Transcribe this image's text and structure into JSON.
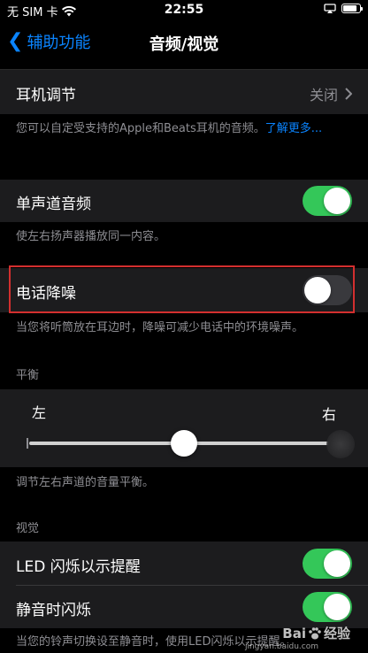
{
  "status_bar": {
    "carrier": "无 SIM 卡",
    "time": "22:55",
    "wifi_icon": "wifi-icon",
    "battery_level": 0.85
  },
  "nav": {
    "back_label": "辅助功能",
    "title": "音频/视觉"
  },
  "headphone": {
    "label": "耳机调节",
    "value": "关闭",
    "footer": "您可以自定受支持的Apple和Beats耳机的音频。",
    "footer_link": "了解更多..."
  },
  "mono_audio": {
    "label": "单声道音频",
    "on": true,
    "footer": "使左右扬声器播放同一内容。"
  },
  "phone_noise": {
    "label": "电话降噪",
    "on": false,
    "footer": "当您将听筒放在耳边时，降噪可减少电话中的环境噪声。"
  },
  "balance": {
    "header": "平衡",
    "left_label": "左",
    "right_label": "右",
    "value": 0.5,
    "footer": "调节左右声道的音量平衡。"
  },
  "visual": {
    "header": "视觉",
    "led_flash": {
      "label": "LED 闪烁以示提醒",
      "on": true
    },
    "silent_flash": {
      "label": "静音时闪烁",
      "on": true
    },
    "footer": "当您的铃声切换设至静音时，使用LED闪烁以示提醒。"
  },
  "watermark": {
    "brand": "Bai",
    "brand2": "经验",
    "sub": "jingyan.baidu.com"
  },
  "colors": {
    "accent": "#0a84ff",
    "toggle_on": "#34c759",
    "toggle_off": "#39393d",
    "highlight": "#d32f2f"
  }
}
